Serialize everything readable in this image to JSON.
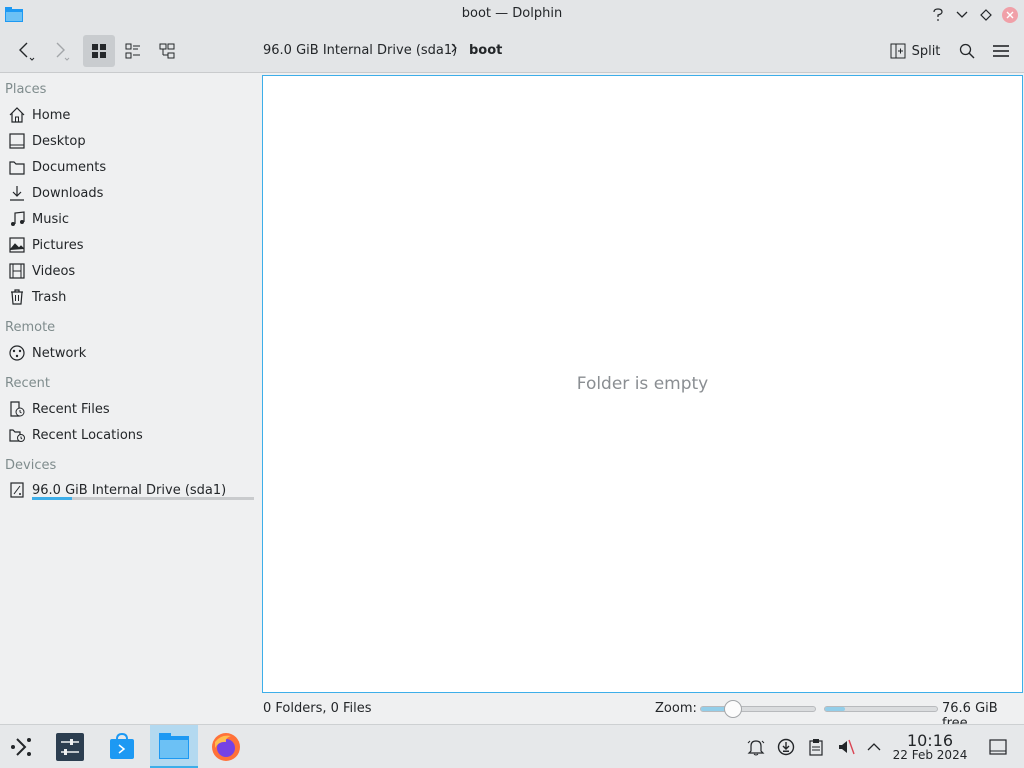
{
  "window": {
    "title": "boot — Dolphin",
    "icons": [
      "folder-app-icon",
      "help-icon",
      "minimize-icon",
      "maximize-icon",
      "close-icon"
    ]
  },
  "toolbar": {
    "split_label": "Split",
    "breadcrumb": [
      {
        "label": "96.0 GiB Internal Drive (sda1)"
      },
      {
        "label": "boot"
      }
    ]
  },
  "sidebar": {
    "places_title": "Places",
    "places": [
      {
        "label": "Home",
        "icon": "home-icon"
      },
      {
        "label": "Desktop",
        "icon": "desktop-icon"
      },
      {
        "label": "Documents",
        "icon": "documents-icon"
      },
      {
        "label": "Downloads",
        "icon": "downloads-icon"
      },
      {
        "label": "Music",
        "icon": "music-icon"
      },
      {
        "label": "Pictures",
        "icon": "pictures-icon"
      },
      {
        "label": "Videos",
        "icon": "videos-icon"
      },
      {
        "label": "Trash",
        "icon": "trash-icon"
      }
    ],
    "remote_title": "Remote",
    "remote": [
      {
        "label": "Network",
        "icon": "network-icon"
      }
    ],
    "recent_title": "Recent",
    "recent": [
      {
        "label": "Recent Files",
        "icon": "recent-files-icon"
      },
      {
        "label": "Recent Locations",
        "icon": "recent-locations-icon"
      }
    ],
    "devices_title": "Devices",
    "devices": [
      {
        "label": "96.0 GiB Internal Drive (sda1)",
        "icon": "drive-icon",
        "used_fraction": 0.18
      }
    ]
  },
  "view": {
    "empty_message": "Folder is empty"
  },
  "statusbar": {
    "summary": "0 Folders, 0 Files",
    "zoom_label": "Zoom:",
    "zoom_fraction": 0.28,
    "free_fraction": 0.18,
    "free_text": "76.6 GiB free"
  },
  "taskbar": {
    "apps": [
      "app-launcher-icon",
      "system-settings-icon",
      "discover-icon",
      "dolphin-icon",
      "firefox-icon"
    ],
    "clock_time": "10:16",
    "clock_date": "22 Feb 2024"
  },
  "colors": {
    "accent": "#3daee9",
    "window_bg": "#eff0f1",
    "view_bg": "#ffffff"
  }
}
